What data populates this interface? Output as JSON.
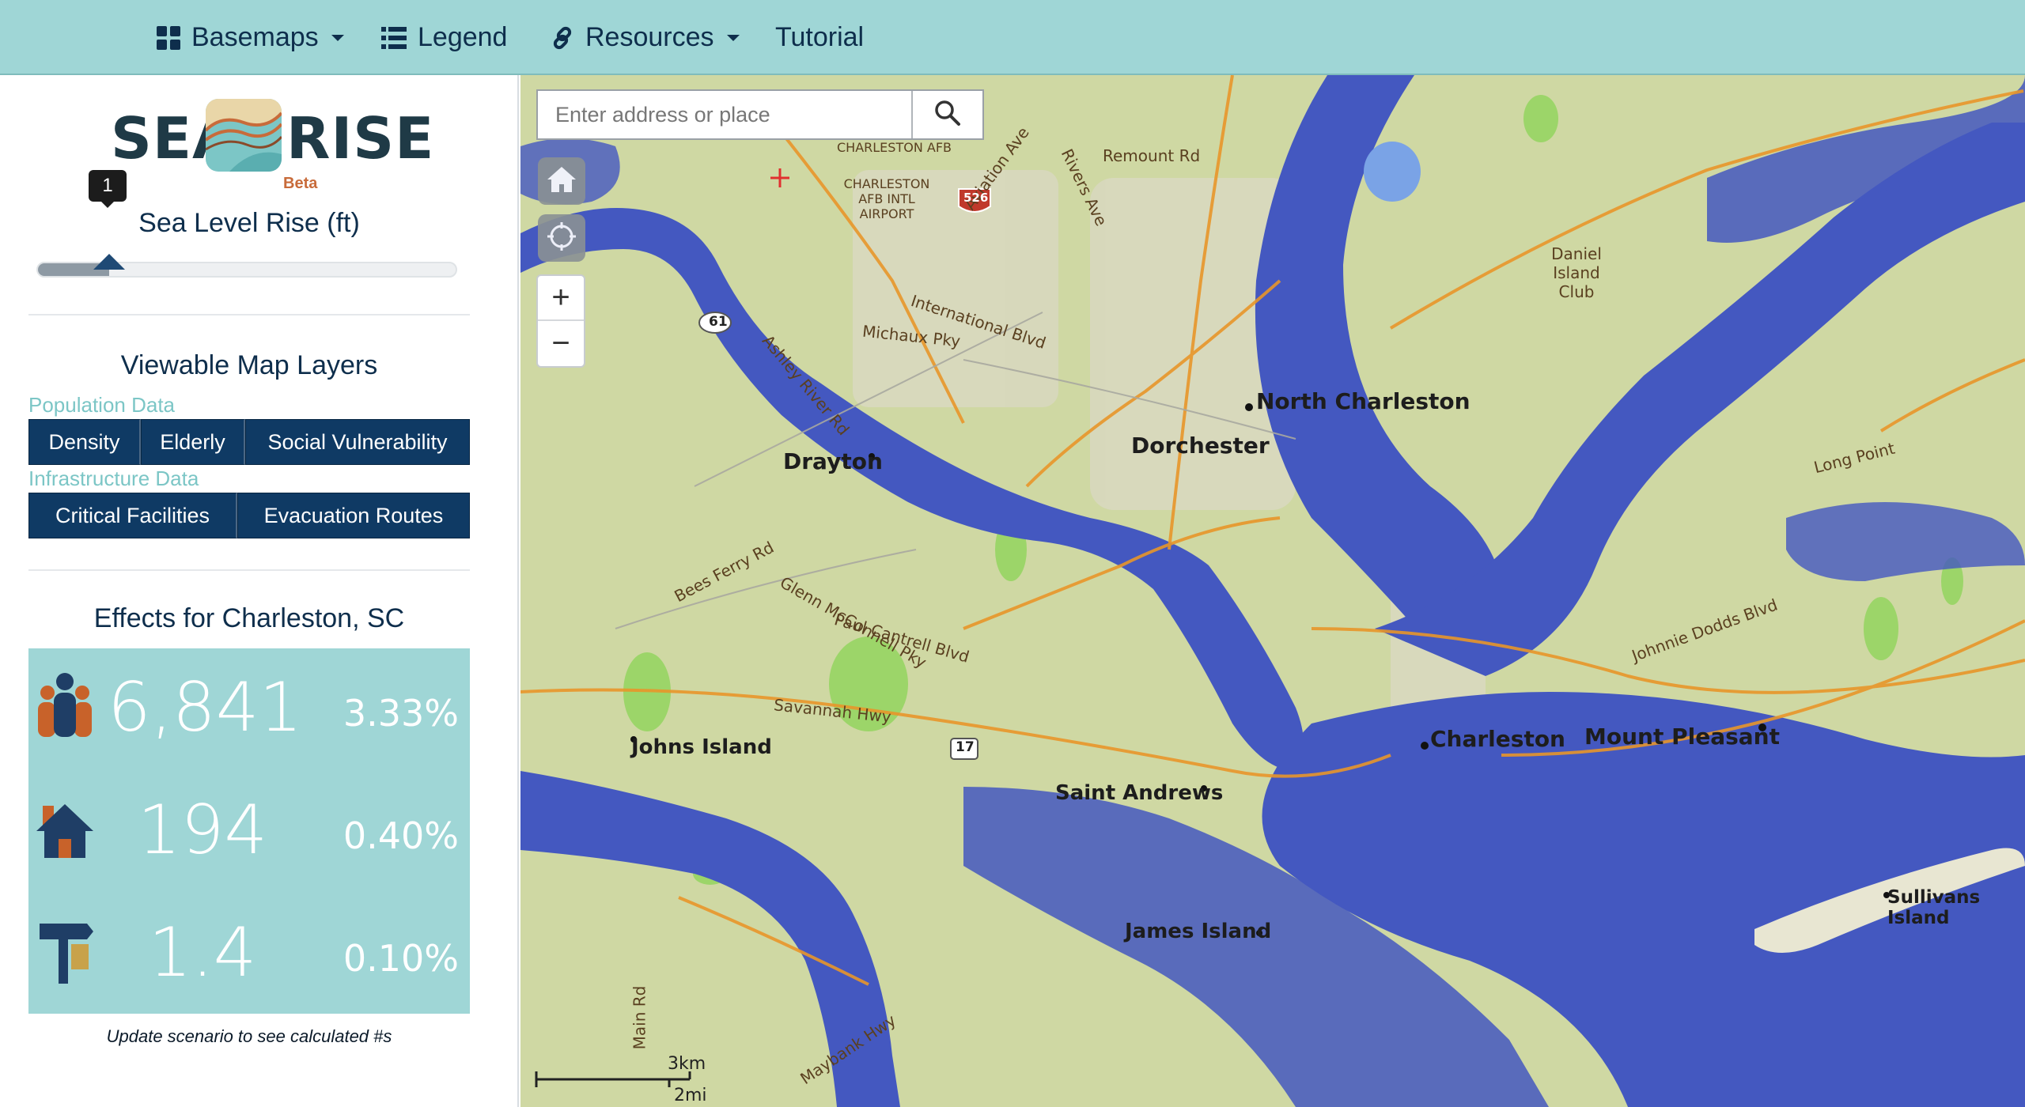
{
  "nav": {
    "basemaps": "Basemaps",
    "legend": "Legend",
    "resources": "Resources",
    "tutorial": "Tutorial"
  },
  "logo": {
    "sea": "SEA",
    "rise": "RISE",
    "beta": "Beta"
  },
  "slider": {
    "title": "Sea Level Rise (ft)",
    "value": "1",
    "fraction": 0.17
  },
  "layers": {
    "title": "Viewable Map Layers",
    "population_label": "Population Data",
    "population_buttons": [
      "Density",
      "Elderly",
      "Social Vulnerability"
    ],
    "infrastructure_label": "Infrastructure Data",
    "infrastructure_buttons": [
      "Critical Facilities",
      "Evacuation Routes"
    ]
  },
  "effects": {
    "title": "Effects for Charleston, SC",
    "rows": [
      {
        "icon": "people-icon",
        "value": "6,841",
        "percent": "3.33%"
      },
      {
        "icon": "house-icon",
        "value": "194",
        "percent": "0.40%"
      },
      {
        "icon": "road-sign-icon",
        "value": "1.4",
        "percent": "0.10%"
      }
    ],
    "note": "Update scenario to see calculated #s"
  },
  "search": {
    "placeholder": "Enter address or place"
  },
  "map": {
    "zoom_in": "+",
    "zoom_out": "−",
    "scale_km": "3km",
    "scale_mi": "2mi",
    "water_color": "#4458c0",
    "land_color": "#cfd8a3",
    "labels": {
      "north_charleston": "North Charleston",
      "dorchester": "Dorchester",
      "drayton": "Drayton",
      "charleston": "Charleston",
      "mount_pleasant": "Mount Pleasant",
      "johns_island": "Johns Island",
      "saint_andrews": "Saint Andrews",
      "james_island": "James Island",
      "sullivans_island": "Sullivans Island",
      "daniel_island_club": "Daniel Island Club",
      "charleston_afb": "CHARLESTON AFB",
      "charleston_afb_airport": "CHARLESTON AFB INTL AIRPORT",
      "remount_rd": "Remount Rd",
      "savannah_hwy": "Savannah Hwy",
      "bees_ferry_rd": "Bees Ferry Rd",
      "paul_cantrell_blvd": "Paul Cantrell Blvd",
      "glenn_mcconnell_pky": "Glenn McConnell Pky",
      "johnnie_dodds_blvd": "Johnnie Dodds Blvd",
      "long_point": "Long Point",
      "international_blvd": "International Blvd",
      "michaux_pky": "Michaux Pky",
      "aviation_ave": "Aviation Ave",
      "rivers_ave": "Rivers Ave",
      "ashley_river_rd": "Ashley River Rd",
      "maybank_hwy": "Maybank Hwy",
      "main_rd": "Main Rd",
      "rt_61": "61",
      "rt_17": "17",
      "rt_526": "526"
    }
  }
}
